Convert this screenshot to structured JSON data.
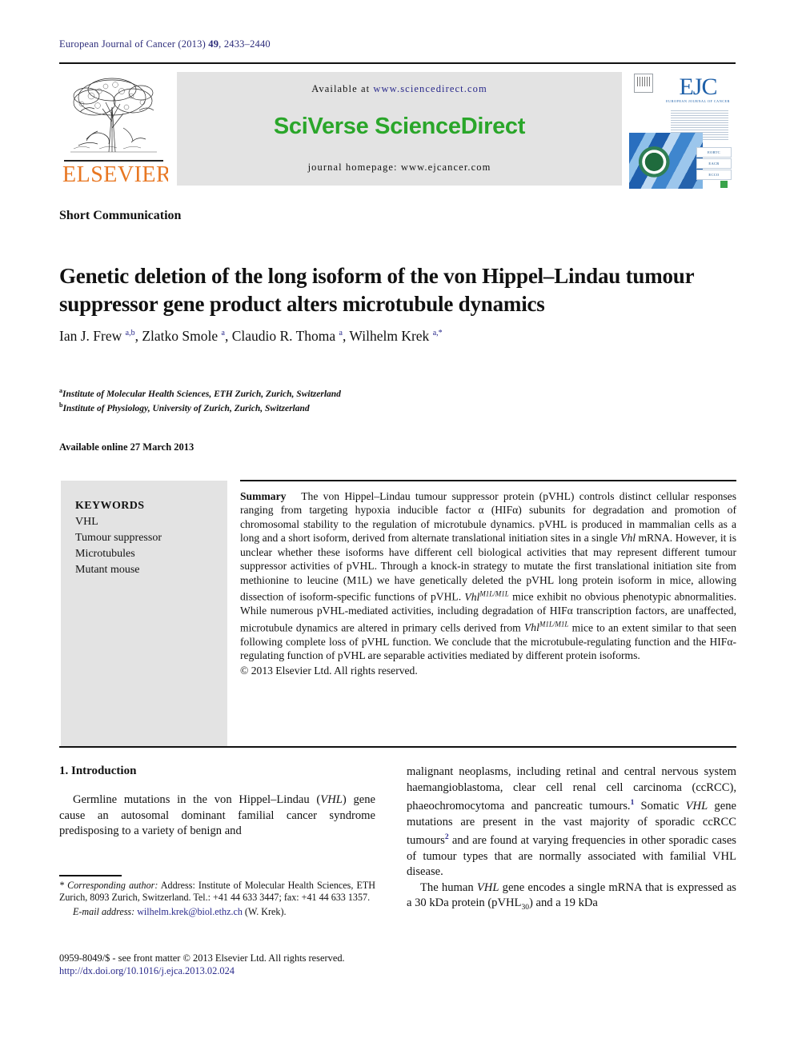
{
  "running_head": {
    "journal": "European Journal of Cancer",
    "year": "(2013)",
    "volume": "49",
    "pages": ", 2433–2440"
  },
  "masthead": {
    "publisher_logo_label": "ELSEVIER",
    "available_at_prefix": "Available at ",
    "available_at_url": "www.sciencedirect.com",
    "brand": "SciVerse ScienceDirect",
    "homepage_line": "journal homepage: www.ejcancer.com",
    "cover": {
      "title": "EJC",
      "subtitle": "EUROPEAN JOURNAL OF CANCER",
      "badges": [
        "EORTC",
        "EACR",
        "ECCO"
      ]
    }
  },
  "article": {
    "section_label": "Short Communication",
    "title": "Genetic deletion of the long isoform of the von Hippel–Lindau tumour suppressor gene product alters microtubule dynamics",
    "authors_html": "Ian J. Frew <sup>a,b</sup>, Zlatko Smole <sup>a</sup>, Claudio R. Thoma <sup>a</sup>, Wilhelm Krek <sup>a,*</sup>",
    "affiliations": [
      {
        "mark": "a",
        "text": "Institute of Molecular Health Sciences, ETH Zurich, Zurich, Switzerland"
      },
      {
        "mark": "b",
        "text": "Institute of Physiology, University of Zurich, Zurich, Switzerland"
      }
    ],
    "available_online": "Available online 27 March 2013"
  },
  "keywords": {
    "heading": "KEYWORDS",
    "items": [
      "VHL",
      "Tumour suppressor",
      "Microtubules",
      "Mutant mouse"
    ]
  },
  "abstract": {
    "label": "Summary",
    "text_html": "The von Hippel–Lindau tumour suppressor protein (pVHL) controls distinct cellular responses ranging from targeting hypoxia inducible factor α (HIFα) subunits for degradation and promotion of chromosomal stability to the regulation of microtubule dynamics. pVHL is produced in mammalian cells as a long and a short isoform, derived from alternate translational initiation sites in a single <i>Vhl</i> mRNA. However, it is unclear whether these isoforms have different cell biological activities that may represent different tumour suppressor activities of pVHL. Through a knock-in strategy to mutate the first translational initiation site from methionine to leucine (M1L) we have genetically deleted the pVHL long protein isoform in mice, allowing dissection of isoform-specific functions of pVHL. <i>Vhl<sup>M1L/M1L</sup></i> mice exhibit no obvious phenotypic abnormalities. While numerous pVHL-mediated activities, including degradation of HIFα transcription factors, are unaffected, microtubule dynamics are altered in primary cells derived from <i>Vhl<sup>M1L/M1L</sup></i> mice to an extent similar to that seen following complete loss of pVHL function. We conclude that the microtubule-regulating function and the HIFα-regulating function of pVHL are separable activities mediated by different protein isoforms.",
    "copyright": "© 2013 Elsevier Ltd. All rights reserved."
  },
  "introduction": {
    "heading": "1. Introduction",
    "left_paragraph_html": "Germline mutations in the von Hippel–Lindau (<i>VHL</i>) gene cause an autosomal dominant familial cancer syndrome predisposing to a variety of benign and",
    "right_paragraph_continuation_html": "malignant neoplasms, including retinal and central nervous system haemangioblastoma, clear cell renal cell carcinoma (ccRCC), phaeochromocytoma and pancreatic tumours.<sup>1</sup> Somatic <i>VHL</i> gene mutations are present in the vast majority of sporadic ccRCC tumours<sup>2</sup> and are found at varying frequencies in other sporadic cases of tumour types that are normally associated with familial VHL disease.",
    "right_paragraph_2_html": "The human <i>VHL</i> gene encodes a single mRNA that is expressed as a 30 kDa protein (pVHL<sub>30</sub>) and a 19 kDa"
  },
  "footnote": {
    "corresponding_label": "* Corresponding author:",
    "corresponding_text": " Address: Institute of Molecular Health Sciences, ETH Zurich, 8093 Zurich, Switzerland. Tel.: +41 44 633 3447; fax: +41 44 633 1357.",
    "email_label": "E-mail address:",
    "email": "wilhelm.krek@biol.ethz.ch",
    "email_owner": " (W. Krek)."
  },
  "bottom_matter": {
    "issn_line": "0959-8049/$ - see front matter © 2013 Elsevier Ltd. All rights reserved.",
    "doi": "http://dx.doi.org/10.1016/j.ejca.2013.02.024"
  },
  "colors": {
    "running_head": "#2c2c7a",
    "elsevier_orange": "#e87722",
    "sciencedirect_green": "#2aa62a",
    "link_blue": "#2a2a8c",
    "ejc_blue": "#1d5fa8",
    "panel_grey": "#e3e3e3"
  }
}
